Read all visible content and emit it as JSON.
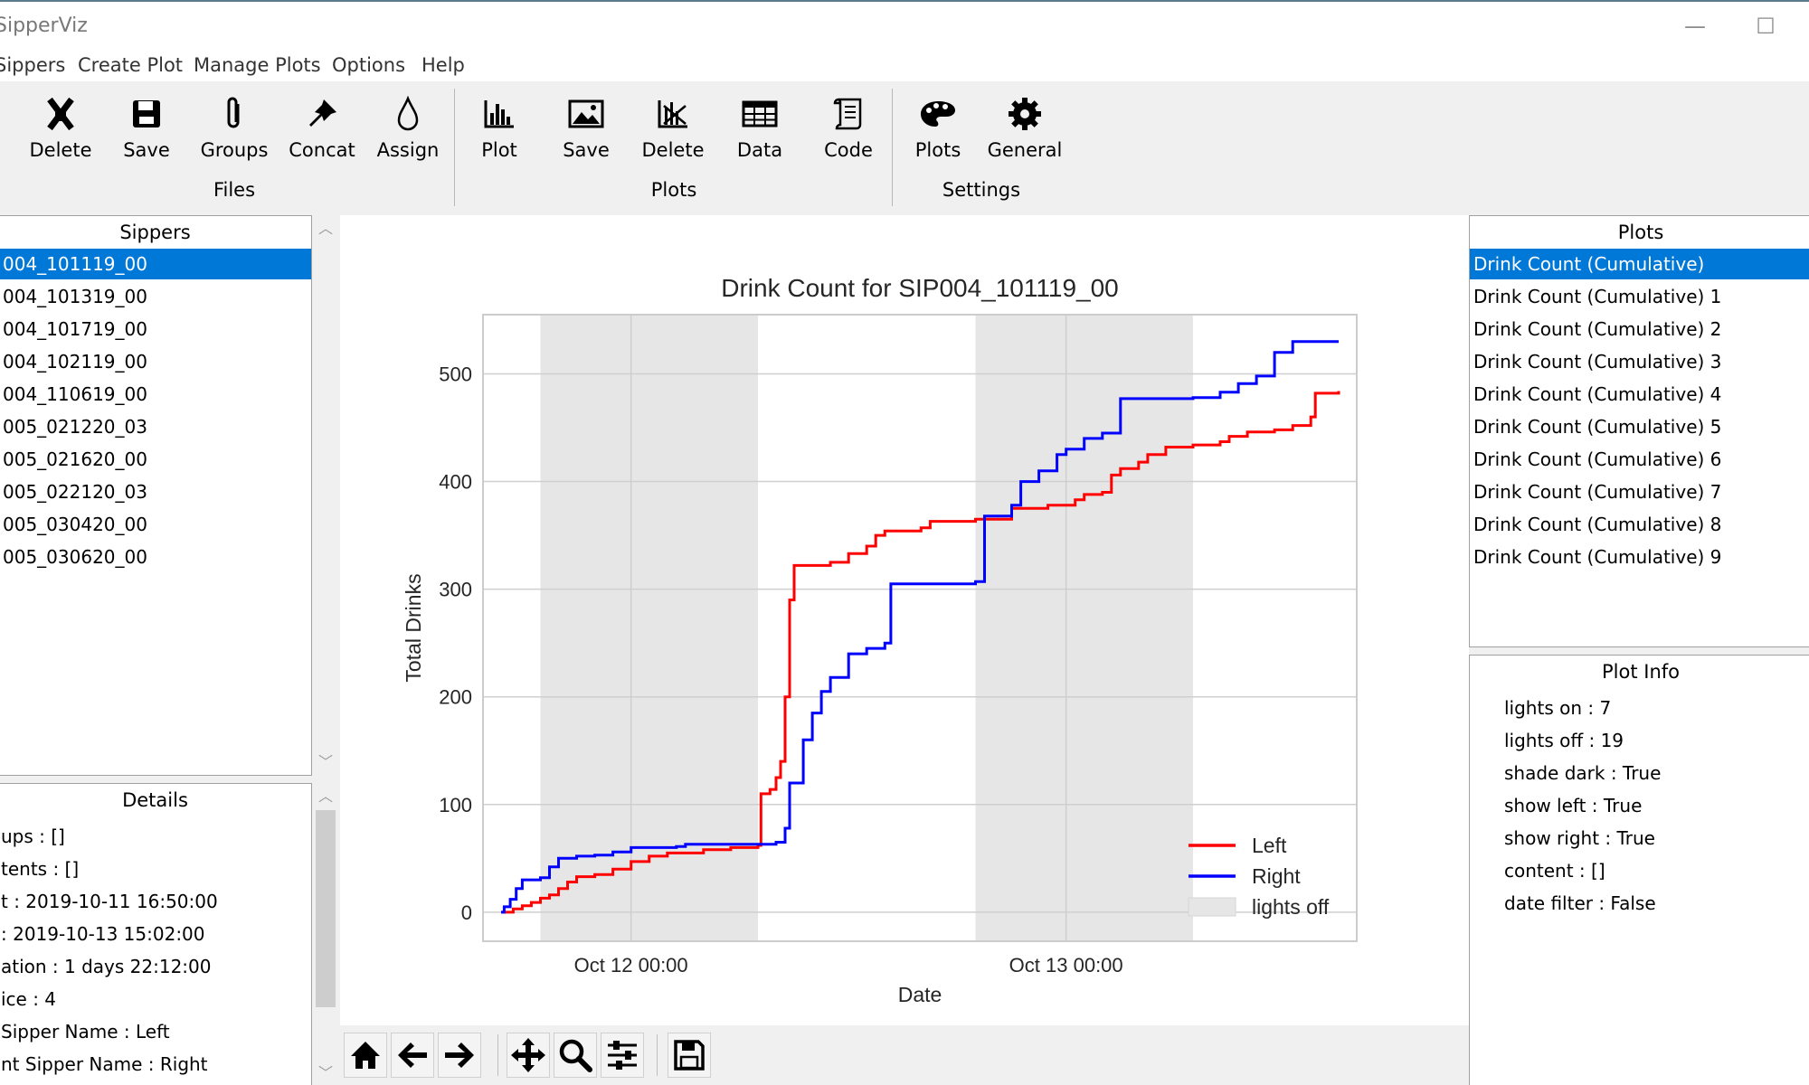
{
  "app": {
    "title": "SipperViz"
  },
  "window": {
    "minimize_glyph": "—",
    "maximize_glyph": "☐"
  },
  "menu": [
    "Sippers",
    "Create Plot",
    "Manage Plots",
    "Options",
    "Help"
  ],
  "ribbon": {
    "groups": [
      {
        "label": "Files",
        "tools": [
          {
            "label": "Delete",
            "icon": "delete-file-icon"
          },
          {
            "label": "Save",
            "icon": "floppy-disk-icon"
          },
          {
            "label": "Groups",
            "icon": "paperclip-icon"
          },
          {
            "label": "Concat",
            "icon": "pushpin-icon"
          },
          {
            "label": "Assign",
            "icon": "droplet-icon"
          }
        ]
      },
      {
        "label": "Plots",
        "tools": [
          {
            "label": "Plot",
            "icon": "bar-chart-icon"
          },
          {
            "label": "Save",
            "icon": "image-icon"
          },
          {
            "label": "Delete",
            "icon": "delete-chart-icon"
          },
          {
            "label": "Data",
            "icon": "table-icon"
          },
          {
            "label": "Code",
            "icon": "scroll-icon"
          }
        ]
      },
      {
        "label": "Settings",
        "tools": [
          {
            "label": "Plots",
            "icon": "palette-icon"
          },
          {
            "label": "General",
            "icon": "gear-icon"
          }
        ]
      }
    ]
  },
  "sippers": {
    "header": "Sippers",
    "selected_index": 0,
    "items": [
      "004_101119_00",
      "004_101319_00",
      "004_101719_00",
      "004_102119_00",
      "004_110619_00",
      "005_021220_03",
      "005_021620_00",
      "005_022120_03",
      "005_030420_00",
      "005_030620_00"
    ]
  },
  "details": {
    "header": "Details",
    "lines": [
      "ups : []",
      "tents : []",
      "t : 2019-10-11 16:50:00",
      ": 2019-10-13 15:02:00",
      "ation : 1 days 22:12:00",
      "ice : 4",
      " Sipper Name : Left",
      "nt Sipper Name : Right"
    ]
  },
  "plots_panel": {
    "header": "Plots",
    "selected_index": 0,
    "items": [
      "Drink Count (Cumulative)",
      "Drink Count (Cumulative) 1",
      "Drink Count (Cumulative) 2",
      "Drink Count (Cumulative) 3",
      "Drink Count (Cumulative) 4",
      "Drink Count (Cumulative) 5",
      "Drink Count (Cumulative) 6",
      "Drink Count (Cumulative) 7",
      "Drink Count (Cumulative) 8",
      "Drink Count (Cumulative) 9"
    ]
  },
  "plot_info": {
    "header": "Plot Info",
    "lines": [
      "lights on : 7",
      "lights off : 19",
      "shade dark : True",
      "show left : True",
      "show right : True",
      "content : []",
      "date filter : False"
    ]
  },
  "nav_toolbar": [
    "home-icon",
    "back-arrow-icon",
    "forward-arrow-icon",
    "pan-icon",
    "zoom-icon",
    "configure-subplots-icon",
    "save-figure-icon"
  ],
  "colors": {
    "left": "#ff0000",
    "right": "#0000ff",
    "shade": "#e6e6e6",
    "selection": "#0078d7"
  },
  "chart_data": {
    "type": "line",
    "title": "Drink Count for SIP004_101119_00",
    "xlabel": "Date",
    "ylabel": "Total Drinks",
    "grid": true,
    "legend_position": "bottom-right",
    "x_unit": "hours",
    "xlim": [
      "2019-10-11 15:50",
      "2019-10-13 16:02"
    ],
    "ylim": [
      -27,
      555
    ],
    "yticks": [
      0,
      100,
      200,
      300,
      400,
      500
    ],
    "xticks": [
      {
        "label": "Oct 12 00:00",
        "x": "2019-10-12 00:00"
      },
      {
        "label": "Oct 13 00:00",
        "x": "2019-10-13 00:00"
      }
    ],
    "shaded_regions": [
      {
        "label": "lights off",
        "start": "2019-10-11 19:00",
        "end": "2019-10-12 07:00"
      },
      {
        "label": "lights off",
        "start": "2019-10-12 19:00",
        "end": "2019-10-13 07:00"
      }
    ],
    "series": [
      {
        "name": "Left",
        "color": "#ff0000",
        "points": [
          [
            "2019-10-11 16:50",
            0
          ],
          [
            "2019-10-11 17:30",
            3
          ],
          [
            "2019-10-11 18:00",
            6
          ],
          [
            "2019-10-11 18:30",
            9
          ],
          [
            "2019-10-11 19:00",
            13
          ],
          [
            "2019-10-11 19:30",
            16
          ],
          [
            "2019-10-11 20:00",
            22
          ],
          [
            "2019-10-11 20:30",
            28
          ],
          [
            "2019-10-11 21:00",
            33
          ],
          [
            "2019-10-11 22:00",
            35
          ],
          [
            "2019-10-11 23:00",
            40
          ],
          [
            "2019-10-12 00:00",
            47
          ],
          [
            "2019-10-12 01:00",
            52
          ],
          [
            "2019-10-12 02:00",
            55
          ],
          [
            "2019-10-12 04:00",
            58
          ],
          [
            "2019-10-12 05:30",
            60
          ],
          [
            "2019-10-12 07:00",
            62
          ],
          [
            "2019-10-12 07:10",
            110
          ],
          [
            "2019-10-12 07:40",
            114
          ],
          [
            "2019-10-12 08:00",
            125
          ],
          [
            "2019-10-12 08:15",
            140
          ],
          [
            "2019-10-12 08:30",
            200
          ],
          [
            "2019-10-12 08:45",
            290
          ],
          [
            "2019-10-12 09:00",
            322
          ],
          [
            "2019-10-12 11:00",
            325
          ],
          [
            "2019-10-12 12:00",
            333
          ],
          [
            "2019-10-12 13:00",
            340
          ],
          [
            "2019-10-12 13:30",
            350
          ],
          [
            "2019-10-12 14:00",
            354
          ],
          [
            "2019-10-12 16:00",
            357
          ],
          [
            "2019-10-12 16:30",
            363
          ],
          [
            "2019-10-12 19:00",
            365
          ],
          [
            "2019-10-12 21:00",
            375
          ],
          [
            "2019-10-12 23:00",
            378
          ],
          [
            "2019-10-13 00:30",
            383
          ],
          [
            "2019-10-13 01:00",
            388
          ],
          [
            "2019-10-13 02:00",
            390
          ],
          [
            "2019-10-13 02:30",
            406
          ],
          [
            "2019-10-13 03:00",
            412
          ],
          [
            "2019-10-13 04:00",
            418
          ],
          [
            "2019-10-13 04:30",
            425
          ],
          [
            "2019-10-13 05:30",
            432
          ],
          [
            "2019-10-13 07:00",
            434
          ],
          [
            "2019-10-13 08:30",
            437
          ],
          [
            "2019-10-13 09:00",
            442
          ],
          [
            "2019-10-13 10:00",
            446
          ],
          [
            "2019-10-13 11:30",
            448
          ],
          [
            "2019-10-13 12:30",
            452
          ],
          [
            "2019-10-13 13:30",
            460
          ],
          [
            "2019-10-13 13:45",
            482
          ],
          [
            "2019-10-13 15:02",
            484
          ]
        ]
      },
      {
        "name": "Right",
        "color": "#0000ff",
        "points": [
          [
            "2019-10-11 16:50",
            0
          ],
          [
            "2019-10-11 17:00",
            5
          ],
          [
            "2019-10-11 17:20",
            12
          ],
          [
            "2019-10-11 17:40",
            22
          ],
          [
            "2019-10-11 18:00",
            30
          ],
          [
            "2019-10-11 19:00",
            32
          ],
          [
            "2019-10-11 19:30",
            42
          ],
          [
            "2019-10-11 20:00",
            50
          ],
          [
            "2019-10-11 21:00",
            52
          ],
          [
            "2019-10-11 22:00",
            53
          ],
          [
            "2019-10-11 23:00",
            56
          ],
          [
            "2019-10-12 00:00",
            60
          ],
          [
            "2019-10-12 02:30",
            61
          ],
          [
            "2019-10-12 03:00",
            63
          ],
          [
            "2019-10-12 08:00",
            65
          ],
          [
            "2019-10-12 08:30",
            78
          ],
          [
            "2019-10-12 08:45",
            120
          ],
          [
            "2019-10-12 09:30",
            160
          ],
          [
            "2019-10-12 10:00",
            185
          ],
          [
            "2019-10-12 10:30",
            205
          ],
          [
            "2019-10-12 11:00",
            218
          ],
          [
            "2019-10-12 12:00",
            240
          ],
          [
            "2019-10-12 13:00",
            245
          ],
          [
            "2019-10-12 14:00",
            250
          ],
          [
            "2019-10-12 14:20",
            305
          ],
          [
            "2019-10-12 19:00",
            307
          ],
          [
            "2019-10-12 19:30",
            368
          ],
          [
            "2019-10-12 21:00",
            378
          ],
          [
            "2019-10-12 21:30",
            400
          ],
          [
            "2019-10-12 22:30",
            410
          ],
          [
            "2019-10-12 23:30",
            425
          ],
          [
            "2019-10-13 00:00",
            430
          ],
          [
            "2019-10-13 01:00",
            440
          ],
          [
            "2019-10-13 02:00",
            445
          ],
          [
            "2019-10-13 03:00",
            477
          ],
          [
            "2019-10-13 07:00",
            478
          ],
          [
            "2019-10-13 08:30",
            483
          ],
          [
            "2019-10-13 09:30",
            491
          ],
          [
            "2019-10-13 10:30",
            498
          ],
          [
            "2019-10-13 11:30",
            520
          ],
          [
            "2019-10-13 12:30",
            530
          ],
          [
            "2019-10-13 15:02",
            530
          ]
        ]
      }
    ],
    "legend": [
      {
        "label": "Left",
        "kind": "line",
        "color": "#ff0000"
      },
      {
        "label": "Right",
        "kind": "line",
        "color": "#0000ff"
      },
      {
        "label": "lights off",
        "kind": "patch",
        "color": "#e6e6e6"
      }
    ]
  }
}
